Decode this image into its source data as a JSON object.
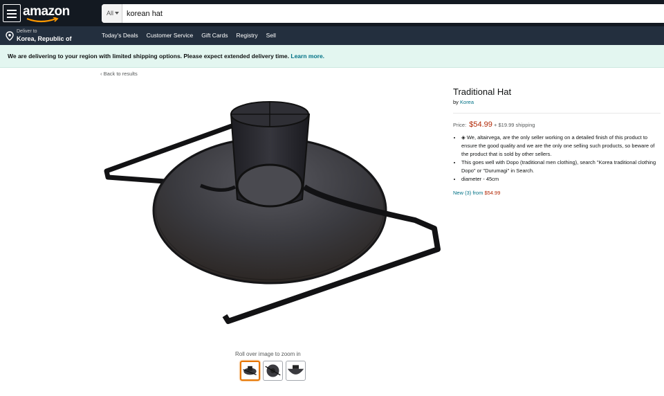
{
  "header": {
    "logo": "amazon",
    "search_category": "All",
    "search_value": "korean hat"
  },
  "subnav": {
    "deliver_line1": "Deliver to",
    "deliver_line2": "Korea, Republic of",
    "links": [
      "Today's Deals",
      "Customer Service",
      "Gift Cards",
      "Registry",
      "Sell"
    ]
  },
  "banner": {
    "text": "We are delivering to your region with limited shipping options. Please expect extended delivery time.",
    "link": "Learn more."
  },
  "back_link": "‹ Back to results",
  "image": {
    "zoom_hint": "Roll over image to zoom in",
    "thumbnail_count": 3
  },
  "product": {
    "title": "Traditional Hat",
    "by_prefix": "by",
    "brand": "Korea",
    "price_label": "Price:",
    "price": "$54.99",
    "shipping": "+ $19.99 shipping",
    "bullets": [
      "◈ We, altairvega, are the only seller working on a detailed finish of this product to ensure the good quality and we are the only one selling such products, so beware of the product that is sold by other sellers.",
      "This goes well with Dopo (traditional men clothing), search \"Korea traditional clothing Dopo\" or \"Durumagi\" in Search.",
      "diameter - 45cm"
    ],
    "new_from_text": "New (3) from",
    "new_from_price": "$54.99"
  },
  "colors": {
    "nav_bg": "#131921",
    "subnav_bg": "#232f3e",
    "banner_bg": "#e3f6f0",
    "link": "#007185",
    "price": "#b12704",
    "thumb_selected": "#e77600"
  }
}
